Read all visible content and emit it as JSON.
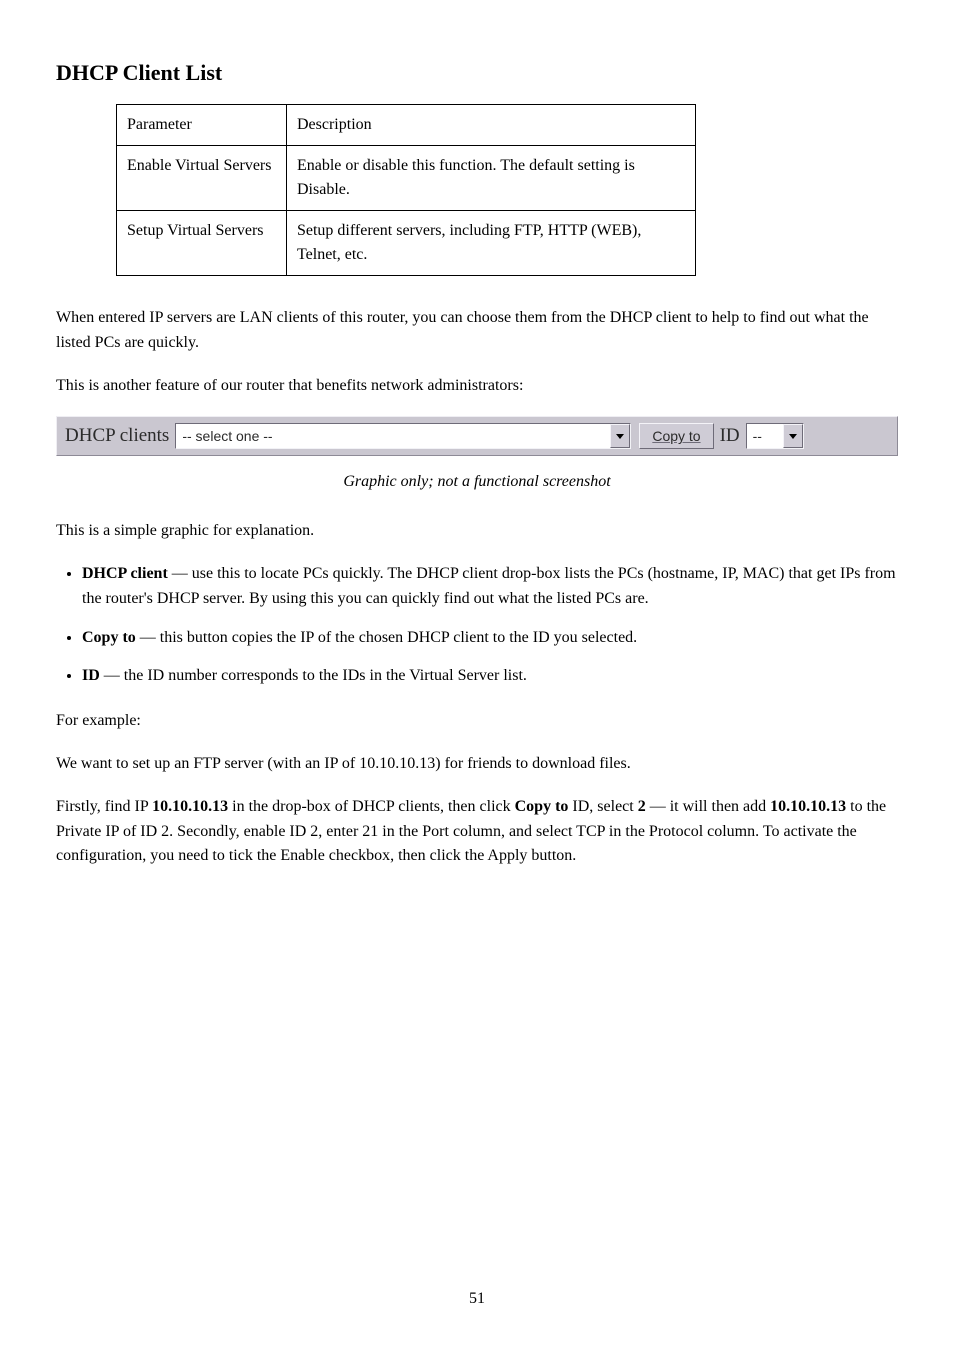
{
  "page": {
    "title": "DHCP Client List",
    "footer_page": "51"
  },
  "spec_table": {
    "rows": [
      {
        "k": "Parameter",
        "v": "Description"
      },
      {
        "k": "Enable Virtual Servers",
        "v": "Enable or disable this function. The default setting is Disable."
      },
      {
        "k": "Setup Virtual Servers",
        "v": "Setup different servers, including FTP, HTTP (WEB), Telnet, etc."
      }
    ]
  },
  "paragraphs": {
    "intro": "When entered IP servers are LAN clients of this router, you can choose them from the DHCP client to help to find out what the listed PCs are quickly.",
    "benefits_lead": "This is another feature of our router that benefits network administrators:",
    "after_graphic_1": "This is a simple graphic for explanation.",
    "after_graphic_2": "For example:"
  },
  "dhcp_bar": {
    "label_clients": "DHCP clients",
    "select_clients_placeholder": "-- select one --",
    "button_copy": "Copy to",
    "label_id": "ID",
    "select_id_placeholder": "--"
  },
  "caption": "Graphic only; not a functional screenshot",
  "tips": [
    {
      "label": "DHCP client",
      "rest": " — use this to locate PCs quickly. The DHCP client drop-box lists the PCs (hostname, IP, MAC) that get IPs from the router's DHCP server. By using this you can quickly find out what the listed PCs are."
    },
    {
      "label": "Copy to",
      "rest": " — this button copies the IP of the chosen DHCP client to the ID you selected."
    },
    {
      "label": "ID",
      "rest": " — the ID number corresponds to the IDs in the Virtual Server list."
    }
  ],
  "example": {
    "line1": "We want to set up an FTP server (with an IP of 10.10.10.13) for friends to download files.",
    "line2_before": "Firstly, find IP ",
    "ip": "10.10.10.13",
    "line2_mid": " in the drop-box of DHCP clients, then click ",
    "btn": "Copy to",
    "line2_mid2": " ID, select ",
    "id": "2",
    "line2_mid3": " — it will then add ",
    "ip2": "10.10.10.13",
    "line2_after": " to the Private IP of ID 2. Secondly, enable ID 2, enter 21 in the Port column, and select TCP in the Protocol column. To activate the configuration, you need to tick the Enable checkbox, then click the Apply button."
  }
}
